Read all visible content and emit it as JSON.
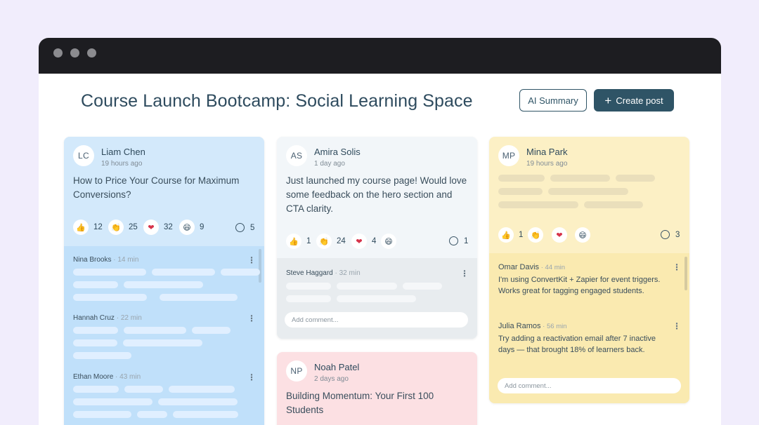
{
  "page": {
    "title": "Course Launch Bootcamp: Social Learning Space",
    "ai_summary_label": "AI Summary",
    "create_post_label": "Create post"
  },
  "posts": [
    {
      "initials": "LC",
      "author": "Liam Chen",
      "time": "19 hours ago",
      "body": "How to Price Your Course for Maximum Conversions?",
      "reactions": {
        "thumbs_up": "12",
        "clap": "25",
        "heart": "32",
        "laugh": "9",
        "comments": "5"
      },
      "comments": [
        {
          "author": "Nina Brooks",
          "time": "14 min"
        },
        {
          "author": "Hannah Cruz",
          "time": "22 min"
        },
        {
          "author": "Ethan Moore",
          "time": "43 min"
        }
      ]
    },
    {
      "initials": "AS",
      "author": "Amira Solis",
      "time": "1 day ago",
      "body": "Just launched my course page! Would love some feedback on the hero section and CTA clarity.",
      "reactions": {
        "thumbs_up": "1",
        "clap": "24",
        "heart": "4",
        "laugh": "",
        "comments": "1"
      },
      "comments": [
        {
          "author": "Steve Haggard",
          "time": "32 min"
        }
      ],
      "add_comment_placeholder": "Add comment..."
    },
    {
      "initials": "MP",
      "author": "Mina Park",
      "time": "19 hours ago",
      "reactions": {
        "thumbs_up": "1",
        "clap": "",
        "heart": "",
        "laugh": "",
        "comments": "3"
      },
      "comments": [
        {
          "author": "Omar Davis",
          "time": "44 min",
          "text": "I'm using ConvertKit + Zapier for event triggers. Works great for tagging engaged students."
        },
        {
          "author": "Julia Ramos",
          "time": "56 min",
          "text": "Try adding a reactivation email after 7 inactive days — that brought 18% of learners back."
        }
      ],
      "add_comment_placeholder": "Add comment..."
    },
    {
      "initials": "NP",
      "author": "Noah Patel",
      "time": "2 days ago",
      "body": "Building Momentum: Your First 100 Students"
    }
  ],
  "colors": {
    "blue_card": "#d3e9fb",
    "blue_comments": "#c0e0fa",
    "grey_card": "#f2f6f9",
    "grey_comments": "#e8ecef",
    "yellow_card": "#fcf0c5",
    "yellow_comments": "#faeab0",
    "pink_card": "#fce0e3",
    "accent": "#2f5466"
  },
  "icons": [
    "thumbs-up-icon",
    "clap-icon",
    "heart-icon",
    "laugh-icon",
    "comment-icon",
    "plus-icon",
    "kebab-icon"
  ]
}
